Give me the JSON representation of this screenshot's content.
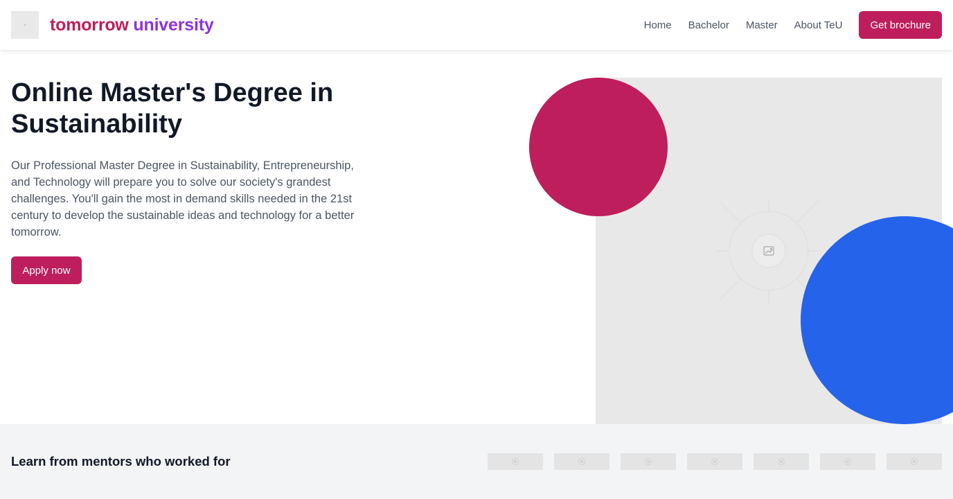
{
  "header": {
    "logo_icon": "image-placeholder-icon",
    "brand_word1": "tomorrow",
    "brand_word2": "university",
    "brand_colors": {
      "word1": "#be1e5b",
      "word2": "#8f33d6"
    },
    "nav": [
      {
        "label": "Home"
      },
      {
        "label": "Bachelor"
      },
      {
        "label": "Master"
      },
      {
        "label": "About TeU"
      }
    ],
    "cta_label": "Get brochure"
  },
  "hero": {
    "title": "Online Master's Degree in Sustainability",
    "description": "Our Professional Master Degree in Sustainability, Entrepreneurship, and Technology will prepare you to solve our society's grandest challenges. You'll gain the most in demand skills needed in the 21st century to develop the sustainable ideas and technology for a better tomorrow.",
    "apply_label": "Apply now",
    "image_icon": "image-placeholder-icon"
  },
  "mentors": {
    "title": "Learn from mentors who worked for",
    "logo_icon": "company-logo-placeholder-icon"
  },
  "colors": {
    "accent": "#be1e5b",
    "decor_red": "#be1e5b",
    "decor_blue": "#2563eb",
    "placeholder_bg": "#e8e8e8",
    "section_bg": "#f3f4f6"
  }
}
